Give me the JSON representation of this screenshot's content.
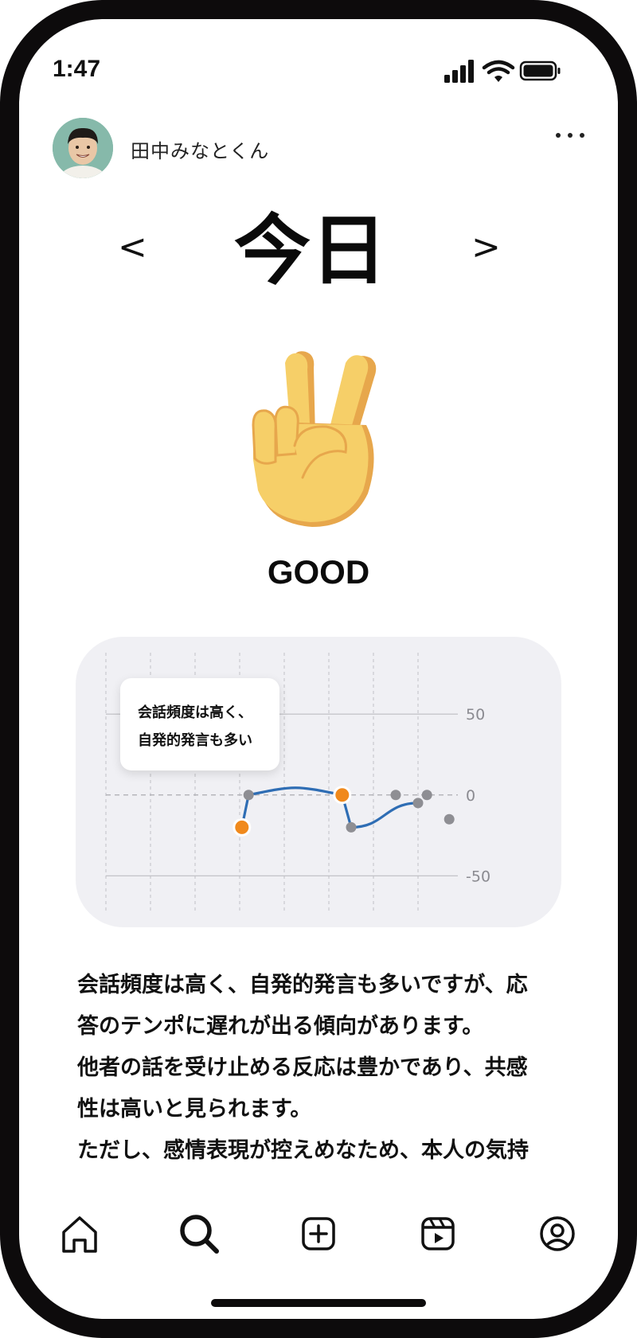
{
  "status_bar": {
    "time": "1:47",
    "icons": [
      "signal-icon",
      "wifi-icon",
      "battery-icon"
    ]
  },
  "profile": {
    "name": "田中みなとくん",
    "avatar": "child-avatar"
  },
  "day_nav": {
    "prev": "<",
    "title": "今日",
    "next": ">"
  },
  "rating": {
    "icon": "victory-hand-icon",
    "label": "GOOD"
  },
  "chart": {
    "tooltip_line1": "会話頻度は高く、",
    "tooltip_line2": "自発的発言も多い",
    "colors": {
      "line": "#2e6db4",
      "highlight": "#f0891c",
      "point": "#8e8e93"
    }
  },
  "chart_data": {
    "type": "line",
    "ylim": [
      -72,
      88
    ],
    "y_ticks": [
      {
        "value": 50,
        "label": "50"
      },
      {
        "value": 0,
        "label": "0"
      },
      {
        "value": -50,
        "label": "-50"
      }
    ],
    "x_grid_count": 8,
    "line": [
      {
        "x": 3.05,
        "y": -20
      },
      {
        "x": 3.2,
        "y": 0
      },
      {
        "x": 5.3,
        "y": 0
      },
      {
        "x": 5.5,
        "y": -20
      },
      {
        "x": 7,
        "y": -5
      }
    ],
    "highlighted_points": [
      {
        "x": 3.05,
        "y": -20
      },
      {
        "x": 5.3,
        "y": 0
      }
    ],
    "points": [
      {
        "x": 3.2,
        "y": 0
      },
      {
        "x": 5.5,
        "y": -20
      },
      {
        "x": 6.5,
        "y": 0
      },
      {
        "x": 7,
        "y": -5
      },
      {
        "x": 7.2,
        "y": 0
      },
      {
        "x": 7.7,
        "y": -15
      }
    ]
  },
  "description": {
    "lines": [
      "会話頻度は高く、自発的発言も多いですが、応",
      "答のテンポに遅れが出る傾向があります。",
      "他者の話を受け止める反応は豊かであり、共感",
      "性は高いと見られます。",
      "ただし、感情表現が控えめなため、本人の気持"
    ]
  },
  "tab_bar": {
    "items": [
      "home-icon",
      "search-icon",
      "create-post-icon",
      "reels-icon",
      "profile-icon"
    ],
    "active": "search-icon"
  }
}
